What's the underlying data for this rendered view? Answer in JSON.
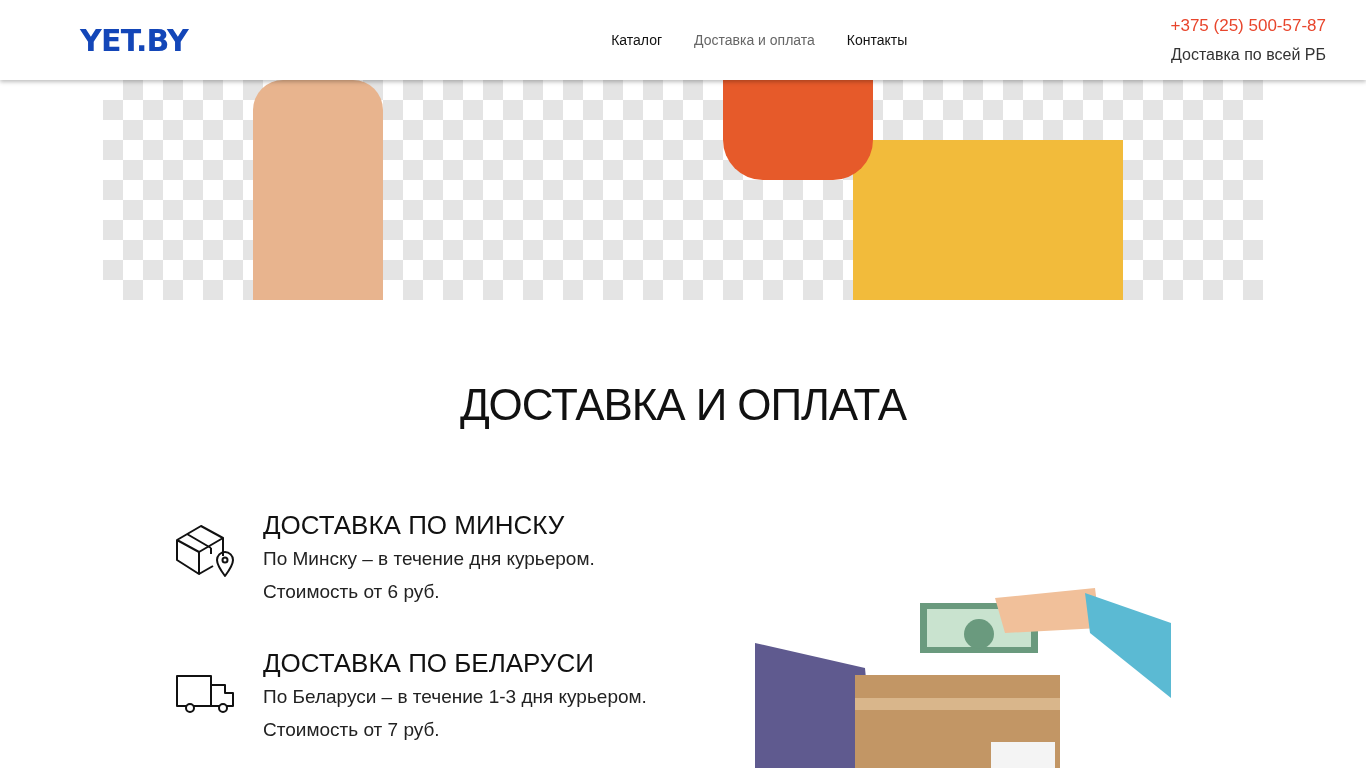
{
  "header": {
    "logo": "YET.BY",
    "nav": [
      {
        "label": "Каталог",
        "selected": false
      },
      {
        "label": "Доставка и оплата",
        "selected": true
      },
      {
        "label": "Контакты",
        "selected": false
      }
    ],
    "phone": "+375 (25) 500-57-87",
    "note": "Доставка по всей РБ"
  },
  "title": "ДОСТАВКА И ОПЛАТА",
  "sections": [
    {
      "kind": "city",
      "heading": "ДОСТАВКА ПО МИНСКУ",
      "lines": [
        "По Минску – в течение дня курьером.",
        "Стоимость от 6 руб."
      ]
    },
    {
      "kind": "country",
      "heading": "ДОСТАВКА ПО БЕЛАРУСИ",
      "lines": [
        "По Беларуси – в течение 1-3 дня курьером.",
        "Стоимость от 7 руб."
      ]
    }
  ]
}
